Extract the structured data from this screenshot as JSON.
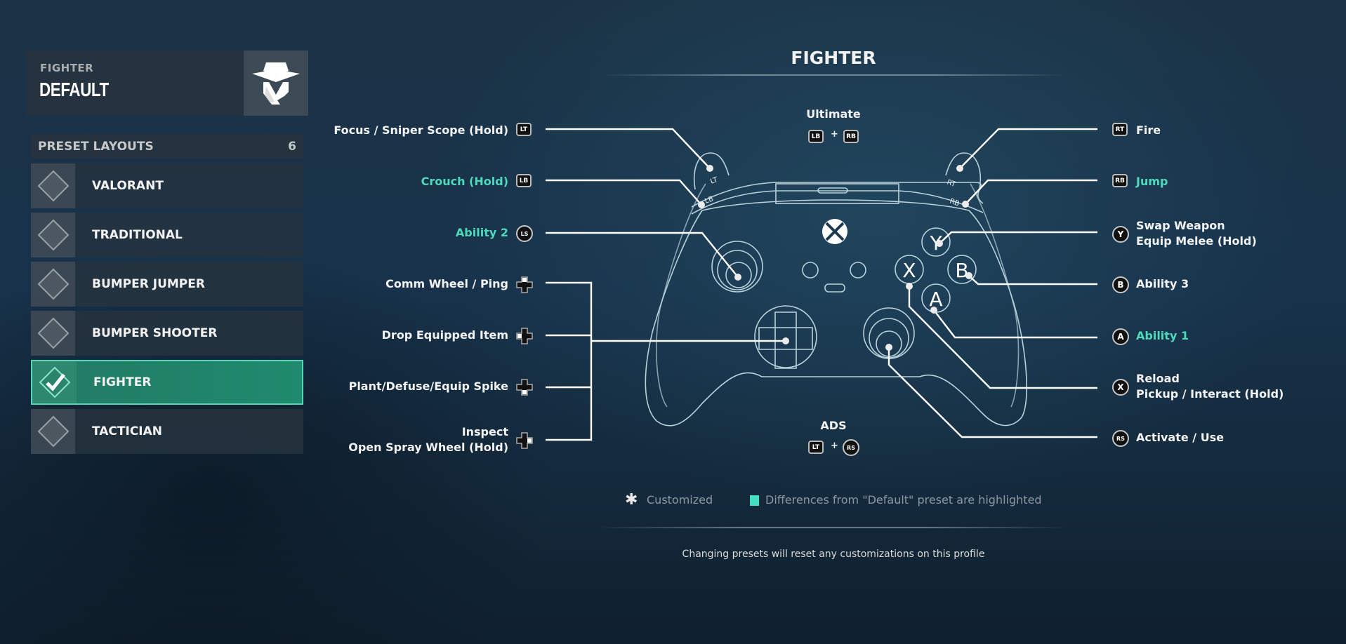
{
  "agent": {
    "role": "FIGHTER",
    "profile": "DEFAULT",
    "icon": "agent-hat-mask-icon"
  },
  "presets": {
    "header": "PRESET LAYOUTS",
    "count": "6",
    "items": [
      {
        "label": "VALORANT",
        "selected": false
      },
      {
        "label": "TRADITIONAL",
        "selected": false
      },
      {
        "label": "BUMPER JUMPER",
        "selected": false
      },
      {
        "label": "BUMPER SHOOTER",
        "selected": false
      },
      {
        "label": "FIGHTER",
        "selected": true
      },
      {
        "label": "TACTICIAN",
        "selected": false
      }
    ]
  },
  "layout_title": "FIGHTER",
  "combos": {
    "ultimate": {
      "label": "Ultimate",
      "buttons": [
        "LB",
        "RB"
      ],
      "joiner": "+"
    },
    "ads": {
      "label": "ADS",
      "buttons": [
        "LT",
        "RS"
      ],
      "joiner": "+"
    }
  },
  "left_bindings": [
    {
      "lines": [
        "Focus / Sniper Scope (Hold)"
      ],
      "button": "LT",
      "highlighted": false
    },
    {
      "lines": [
        "Crouch (Hold)"
      ],
      "button": "LB",
      "highlighted": true
    },
    {
      "lines": [
        "Ability 2"
      ],
      "button": "LS",
      "highlighted": true
    },
    {
      "lines": [
        "Comm Wheel / Ping"
      ],
      "button": "D-pad Up",
      "highlighted": false
    },
    {
      "lines": [
        "Drop Equipped Item"
      ],
      "button": "D-pad Left",
      "highlighted": false
    },
    {
      "lines": [
        "Plant/Defuse/Equip Spike"
      ],
      "button": "D-pad Down",
      "highlighted": false
    },
    {
      "lines": [
        "Inspect",
        "Open Spray Wheel (Hold)"
      ],
      "button": "D-pad Right",
      "highlighted": false
    }
  ],
  "right_bindings": [
    {
      "lines": [
        "Fire"
      ],
      "button": "RT",
      "highlighted": false
    },
    {
      "lines": [
        "Jump"
      ],
      "button": "RB",
      "highlighted": true
    },
    {
      "lines": [
        "Swap Weapon",
        "Equip Melee (Hold)"
      ],
      "button": "Y",
      "highlighted": false
    },
    {
      "lines": [
        "Ability 3"
      ],
      "button": "B",
      "highlighted": false
    },
    {
      "lines": [
        "Ability 1"
      ],
      "button": "A",
      "highlighted": true
    },
    {
      "lines": [
        "Reload",
        "Pickup / Interact (Hold)"
      ],
      "button": "X",
      "highlighted": false
    },
    {
      "lines": [
        "Activate / Use"
      ],
      "button": "RS",
      "highlighted": false
    }
  ],
  "controller_labels": {
    "lt": "LT",
    "lb": "LB",
    "rt": "RT",
    "rb": "RB",
    "y": "Y",
    "x": "X",
    "b": "B",
    "a": "A"
  },
  "legend": {
    "customized": "Customized",
    "customized_icon": "asterisk-icon",
    "highlighted": "Differences from \"Default\" preset are highlighted"
  },
  "footer": "Changing presets will reset any customizations on this profile",
  "colors": {
    "accent": "#4fd9bd",
    "selected_row": "#1f8a6d",
    "swatch": "#40e0c0"
  }
}
